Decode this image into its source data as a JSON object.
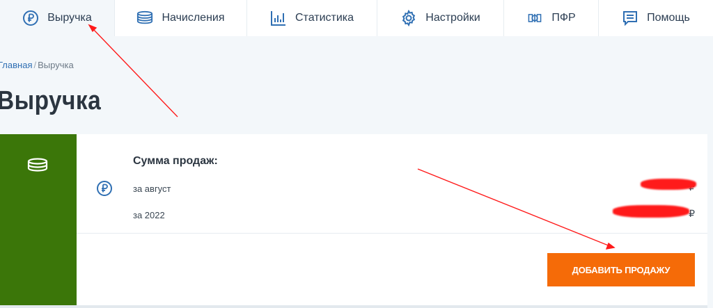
{
  "nav": {
    "items": [
      {
        "label": "Выручка",
        "icon": "ruble-icon",
        "active": true
      },
      {
        "label": "Начисления",
        "icon": "coins-icon"
      },
      {
        "label": "Статистика",
        "icon": "bar-chart-icon"
      },
      {
        "label": "Настройки",
        "icon": "gear-icon"
      },
      {
        "label": "ПФР",
        "icon": "pfr-logo-icon"
      },
      {
        "label": "Помощь",
        "icon": "help-chat-icon"
      }
    ]
  },
  "breadcrumb": {
    "home": "Главная",
    "separator": "/",
    "current": "Выручка"
  },
  "page": {
    "title": "Выручка"
  },
  "card": {
    "heading": "Сумма продаж:",
    "rows": [
      {
        "label": "за август",
        "value": "₽"
      },
      {
        "label": "за 2022",
        "value": "₽"
      }
    ],
    "button": "ДОБАВИТЬ ПРОДАЖУ"
  },
  "colors": {
    "accent": "#2f6fb3",
    "sidebar": "#3b7609",
    "button": "#f56b08",
    "annotation": "#ff1a1a"
  }
}
